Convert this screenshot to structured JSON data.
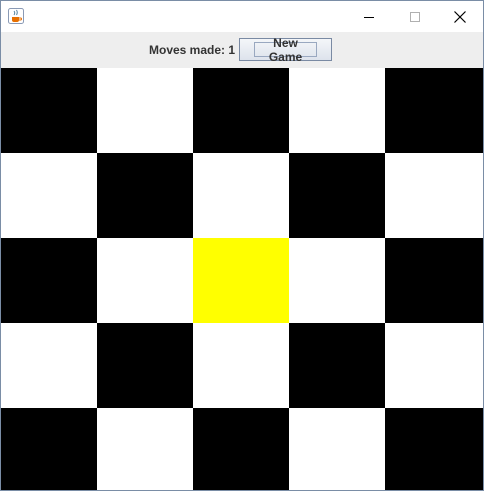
{
  "window": {
    "title": "",
    "icon": "java-cup-icon"
  },
  "toolbar": {
    "moves_label": "Moves made: 1",
    "new_game_label": "New Game"
  },
  "board": {
    "rows": 5,
    "cols": 5,
    "colors": {
      "black": "#000000",
      "white": "#ffffff",
      "highlight": "#ffff00"
    },
    "cells": [
      [
        "black",
        "white",
        "black",
        "white",
        "black"
      ],
      [
        "white",
        "black",
        "white",
        "black",
        "white"
      ],
      [
        "black",
        "white",
        "highlight",
        "white",
        "black"
      ],
      [
        "white",
        "black",
        "white",
        "black",
        "white"
      ],
      [
        "black",
        "white",
        "black",
        "white",
        "black"
      ]
    ]
  }
}
